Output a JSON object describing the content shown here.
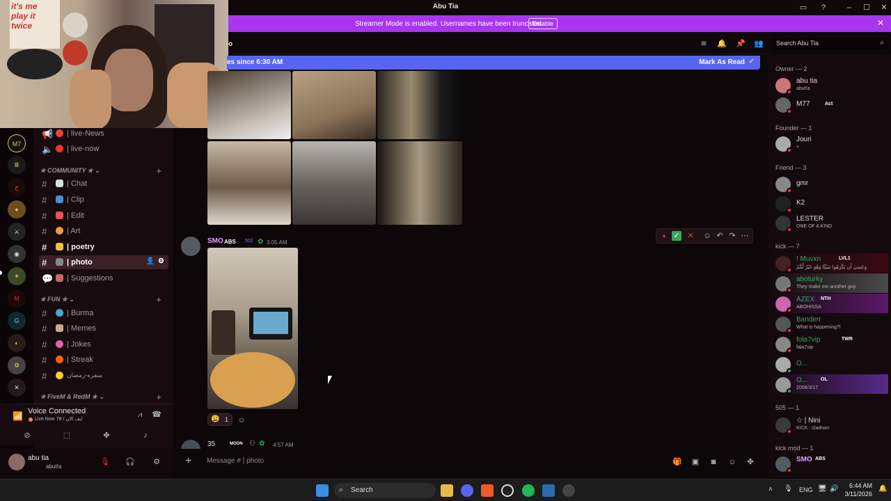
{
  "window": {
    "title": "Abu Tia"
  },
  "banner": {
    "text": "Streamer Mode is enabled. Usernames have been truncated.",
    "disable_label": "Disable"
  },
  "header": {
    "channel_fragment": "o",
    "search_placeholder": "Search Abu Tia"
  },
  "new_messages": {
    "text": "es since 6:30 AM",
    "mark_read": "Mark As Read"
  },
  "channels": {
    "top": [
      {
        "name": "| live-News"
      },
      {
        "name": "| live-now"
      }
    ],
    "categories": [
      {
        "name": "COMMUNITY",
        "items": [
          {
            "name": "| Chat"
          },
          {
            "name": "| Clip"
          },
          {
            "name": "| Edit"
          },
          {
            "name": "| Art"
          },
          {
            "name": "| poetry"
          },
          {
            "name": "| photo"
          },
          {
            "name": "| Suggestions"
          }
        ]
      },
      {
        "name": "FUN",
        "items": [
          {
            "name": "| Burma"
          },
          {
            "name": "| Memes"
          },
          {
            "name": "| Jokes"
          },
          {
            "name": "| Streak"
          },
          {
            "name": "سفره-رمضان"
          }
        ]
      },
      {
        "name": "FiveM & RedM",
        "items": []
      }
    ]
  },
  "voice": {
    "status": "Voice Connected",
    "channel": "Live Now 78 / ايف الان"
  },
  "user": {
    "name": "abu tia",
    "tag": "abut!a"
  },
  "message": {
    "author": "SMO",
    "badge": "ABS",
    "badge_num": "502",
    "time": "3:05 AM",
    "reaction_count": "1"
  },
  "next_message": {
    "author": "35",
    "badge": "MOON",
    "time": "4:57 AM"
  },
  "composer": {
    "placeholder": "Message #  |  photo"
  },
  "members": {
    "sections": [
      {
        "title": "Owner — 2",
        "members": [
          {
            "name": "abu tia",
            "status": "abut!a"
          },
          {
            "name": "M77",
            "status": "",
            "tag": "Act"
          }
        ]
      },
      {
        "title": "Founder — 1",
        "members": [
          {
            "name": "Jouri",
            "status": "+"
          }
        ]
      },
      {
        "title": "Friend — 3",
        "members": [
          {
            "name": "gmr",
            "status": ""
          },
          {
            "name": "K2",
            "status": ""
          },
          {
            "name": "LESTER",
            "status": "ONE OF A KIND"
          }
        ]
      },
      {
        "title": "kick — 7",
        "members": [
          {
            "name": "! Muvxn",
            "status": "وَعَسَىٰ أَن تَكْرَهُوا شَيْئًا وَهُوَ خَيْرٌ لَّكُمْ",
            "tag": "LVL1"
          },
          {
            "name": "aboturky",
            "status": "They make me another guy."
          },
          {
            "name": "AZEX",
            "status": "ABOHISSA",
            "tag": "NTH"
          },
          {
            "name": "Banderr",
            "status": "What is happening?!"
          },
          {
            "name": "fola7vip",
            "status": "fala7vip",
            "tag": "TWR"
          },
          {
            "name": "O...",
            "status": ""
          },
          {
            "name": "O...",
            "status": "2006/3/17",
            "tag": "OL"
          }
        ]
      },
      {
        "title": "505 — 1",
        "members": [
          {
            "name": "☆ | Nini",
            "status": "KICK : i2adnan"
          }
        ]
      },
      {
        "title": "kick mod — 1",
        "members": [
          {
            "name": "SMO",
            "status": "",
            "tag": "ABS"
          }
        ]
      }
    ]
  },
  "taskbar": {
    "search": "Search",
    "lang": "ENG",
    "time": "6:44 AM",
    "date": "3/11/2026"
  },
  "webcam": {
    "poster_text": "it's me\nplay it\ntwice"
  },
  "colors": {
    "banner": "#a935ee",
    "blurple": "#5865f2",
    "channel_bg": "#170b0f",
    "chat_bg": "#0d0709"
  }
}
